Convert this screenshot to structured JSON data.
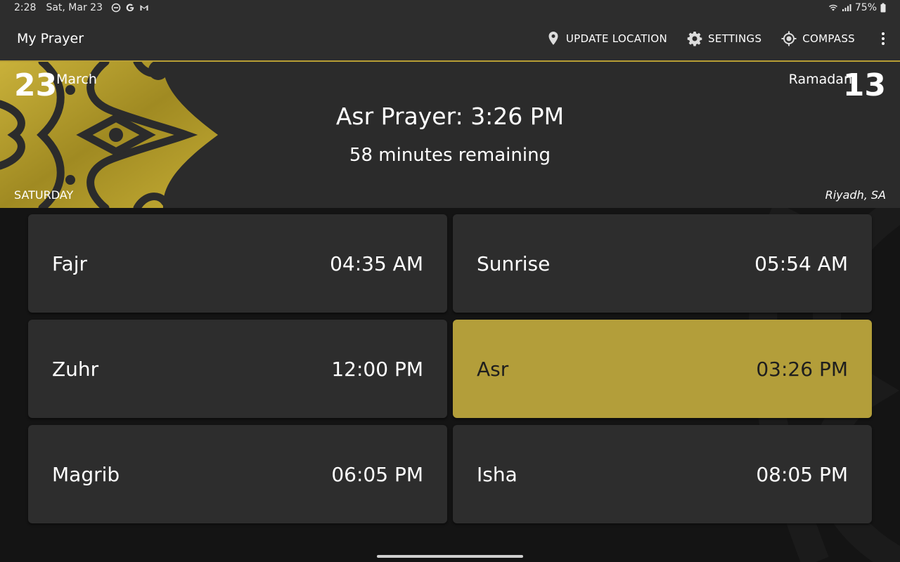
{
  "status_bar": {
    "time": "2:28",
    "date": "Sat, Mar 23",
    "battery": "75%",
    "icons": [
      "do-not-disturb-icon",
      "google-icon",
      "gmail-icon",
      "wifi-icon",
      "signal-icon",
      "battery-icon"
    ]
  },
  "app_bar": {
    "title": "My Prayer",
    "actions": {
      "update_location": "UPDATE LOCATION",
      "settings": "SETTINGS",
      "compass": "COMPASS"
    }
  },
  "header": {
    "day_number": "23",
    "month": "March",
    "hijri_month": "Ramadan",
    "hijri_day": "13",
    "next_prayer": "Asr Prayer: 3:26 PM",
    "remaining": "58 minutes remaining",
    "weekday": "SATURDAY",
    "location": "Riyadh, SA"
  },
  "prayers": [
    {
      "name": "Fajr",
      "time": "04:35 AM"
    },
    {
      "name": "Sunrise",
      "time": "05:54 AM"
    },
    {
      "name": "Zuhr",
      "time": "12:00 PM"
    },
    {
      "name": "Asr",
      "time": "03:26 PM"
    },
    {
      "name": "Magrib",
      "time": "06:05 PM"
    },
    {
      "name": "Isha",
      "time": "08:05 PM"
    }
  ],
  "active_prayer": "Asr",
  "colors": {
    "accent": "#b39e3a",
    "bar": "#2d2d2d",
    "card": "#2d2d2d",
    "background": "#141414"
  }
}
